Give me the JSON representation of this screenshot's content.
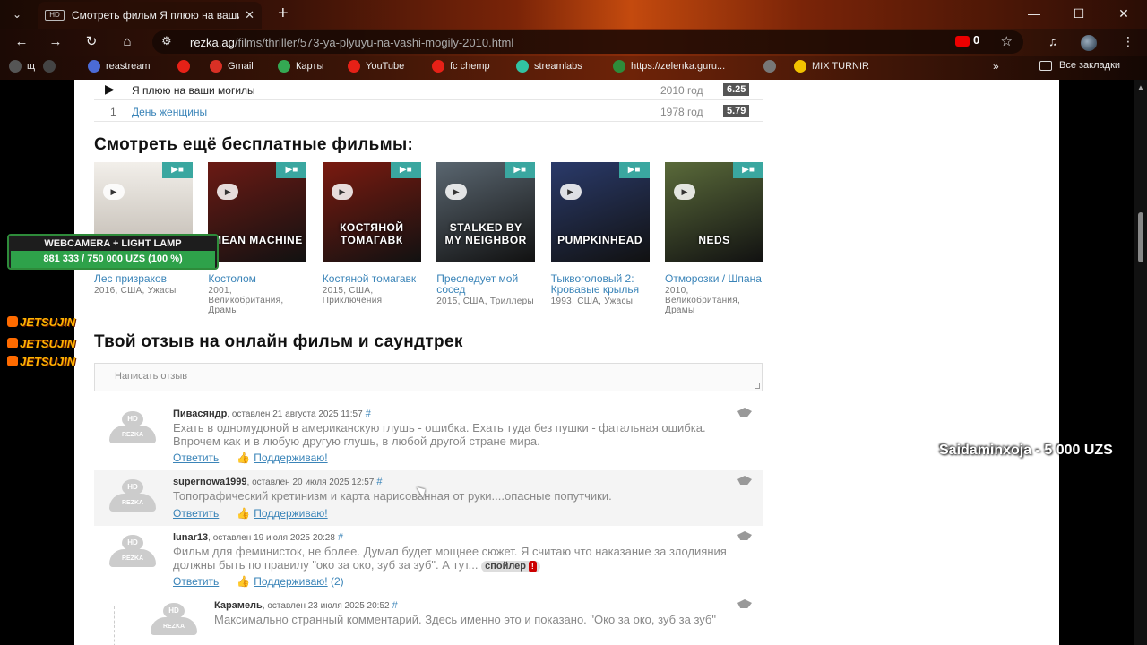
{
  "browser": {
    "tab_title": "Смотреть фильм Я плюю на ваши могилы",
    "tab_favicon_text": "HD",
    "url_host": "rezka.ag",
    "url_path": "/films/thriller/573-ya-plyuyu-na-vashi-mogily-2010.html",
    "youtube_badge_count": "0",
    "bookmarks": [
      {
        "label": "щ",
        "color": "#555555"
      },
      {
        "label": "",
        "color": "#444444"
      },
      {
        "label": "reastream",
        "color": "#4b6bd6"
      },
      {
        "label": "",
        "color": "#e62117"
      },
      {
        "label": "Gmail",
        "color": "#d93025"
      },
      {
        "label": "Карты",
        "color": "#34a853"
      },
      {
        "label": "YouTube",
        "color": "#e62117"
      },
      {
        "label": "fc chemp",
        "color": "#e62117"
      },
      {
        "label": "streamlabs",
        "color": "#31c3a2"
      },
      {
        "label": "https://zelenka.guru...",
        "color": "#2e8b3a"
      },
      {
        "label": "",
        "color": "#777777"
      },
      {
        "label": "MIX TURNIR",
        "color": "#f2c200"
      }
    ],
    "all_bookmarks_label": "Все закладки"
  },
  "rankings": [
    {
      "marker": "▶",
      "title": "Я плюю на ваши могилы",
      "year": "2010 год",
      "rating": "6.25"
    },
    {
      "marker": "1",
      "title": "День женщины",
      "year": "1978 год",
      "rating": "5.79"
    }
  ],
  "more_films": {
    "heading": "Смотреть ещё бесплатные фильмы:",
    "films": [
      {
        "title": "Лес призраков",
        "meta": "2016, США, Ужасы",
        "poster_text": "",
        "bg": "#e6e2dc"
      },
      {
        "title": "Костолом",
        "meta": "2001, Великобритания, Драмы",
        "poster_text": "MEAN MACHINE",
        "bg": "#6b1a14"
      },
      {
        "title": "Костяной томагавк",
        "meta": "2015, США, Приключения",
        "poster_text": "КОСТЯНОЙ ТОМАГАВК",
        "bg": "#7a1a10"
      },
      {
        "title": "Преследует мой сосед",
        "meta": "2015, США, Триллеры",
        "poster_text": "STALKED BY MY NEIGHBOR",
        "bg": "#5a6670"
      },
      {
        "title": "Тыквоголовый 2: Кровавые крылья",
        "meta": "1993, США, Ужасы",
        "poster_text": "PUMPKINHEAD",
        "bg": "#2a3a6a"
      },
      {
        "title": "Отморозки / Шпана",
        "meta": "2010, Великобритания, Драмы",
        "poster_text": "NEDS",
        "bg": "#5a6a3a"
      }
    ]
  },
  "review": {
    "heading": "Твой отзыв на онлайн фильм и саундтрек",
    "placeholder": "Написать отзыв"
  },
  "comments": [
    {
      "author": "Пивасяндр",
      "date": ", оставлен 21 августа 2025 11:57",
      "hash": "#",
      "text": "Ехать в одномудоной в американскую глушь - ошибка. Ехать туда без пушки - фатальная ошибка. Впрочем как и в любую другую глушь, в любой другой стране мира.",
      "reply": "Ответить",
      "support": "Поддерживаю!",
      "count": ""
    },
    {
      "author": "supernowa1999",
      "date": ", оставлен 20 июля 2025 12:57",
      "hash": "#",
      "text": "Топографический кретинизм и карта нарисованная от руки....опасные попутчики.",
      "reply": "Ответить",
      "support": "Поддерживаю!",
      "count": ""
    },
    {
      "author": "lunar13",
      "date": ", оставлен 19 июля 2025 20:28",
      "hash": "#",
      "text": "Фильм для феминисток, не более. Думал будет мощнее сюжет. Я считаю что наказание за злодияния должны быть по правилу \"око за око, зуб за зуб\". А тут...",
      "spoiler": "спойлер",
      "spoiler_badge": "!",
      "reply": "Ответить",
      "support": "Поддерживаю!",
      "count": "(2)"
    },
    {
      "author": "Карамель",
      "date": ", оставлен 23 июля 2025 20:52",
      "hash": "#",
      "text": "Максимально странный комментарий. Здесь именно это и показано. \"Око за око, зуб за зуб\"",
      "reply": "",
      "support": "",
      "count": ""
    }
  ],
  "avatar_label": {
    "head": "HD",
    "body": "REZKA"
  },
  "overlay": {
    "donation_title": "WEBCAMERA + LIGHT LAMP",
    "donation_amount": "881 333 / 750 000 UZS (100 %)",
    "donation_progress": 1.0,
    "streamer_tags": [
      "JETSUJIN",
      "JETSUJIN",
      "JETSUJIN"
    ],
    "donor_line": "Saidaminxoja - 5 000 UZS"
  },
  "colors": {
    "link": "#3a84b8",
    "accent": "#3aa7a0",
    "donation_green": "#2ea24a"
  }
}
